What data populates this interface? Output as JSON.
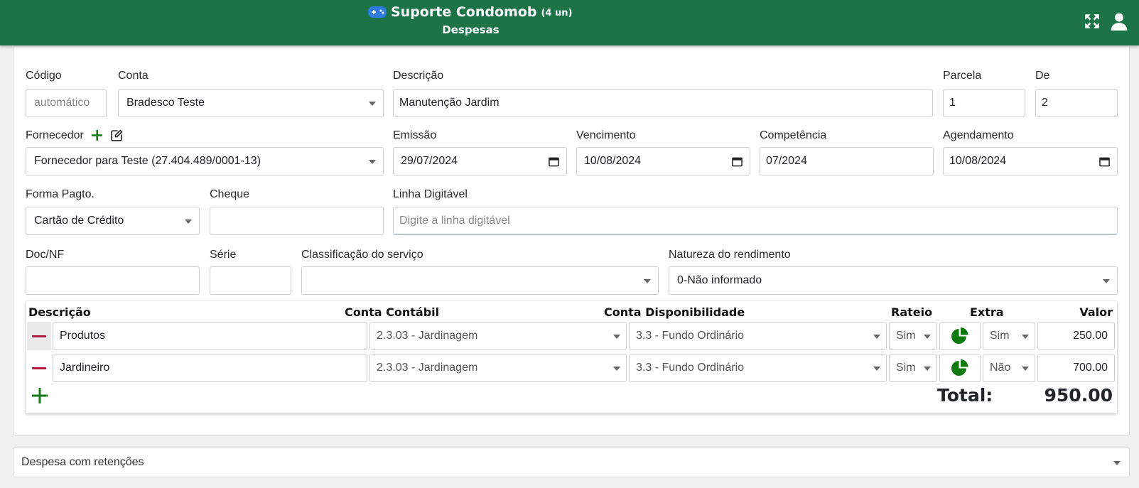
{
  "header": {
    "app_name": "Suporte Condomob",
    "units": "(4 un)",
    "page": "Despesas",
    "brand_color": "#1b7347",
    "icons": [
      "gamepad-icon",
      "fullscreen-icon",
      "user-icon"
    ]
  },
  "form": {
    "codigo": {
      "label": "Código",
      "placeholder": "automático"
    },
    "conta": {
      "label": "Conta",
      "value": "Bradesco Teste"
    },
    "descricao": {
      "label": "Descrição",
      "value": "Manutenção Jardim"
    },
    "parcela": {
      "label": "Parcela",
      "value": "1"
    },
    "de": {
      "label": "De",
      "value": "2"
    },
    "fornecedor": {
      "label": "Fornecedor",
      "value": "Fornecedor para Teste (27.404.489/0001-13)"
    },
    "emissao": {
      "label": "Emissão",
      "value": "29/07/2024"
    },
    "vencimento": {
      "label": "Vencimento",
      "value": "10/08/2024"
    },
    "competencia": {
      "label": "Competência",
      "value": "07/2024"
    },
    "agendamento": {
      "label": "Agendamento",
      "value": "10/08/2024"
    },
    "forma_pagto": {
      "label": "Forma Pagto.",
      "value": "Cartão de Crédito"
    },
    "cheque": {
      "label": "Cheque",
      "value": ""
    },
    "linha_digitavel": {
      "label": "Linha Digitável",
      "placeholder": "Digite a linha digitável"
    },
    "doc_nf": {
      "label": "Doc/NF",
      "value": ""
    },
    "serie": {
      "label": "Série",
      "value": ""
    },
    "classificacao": {
      "label": "Classificação do serviço",
      "value": ""
    },
    "natureza": {
      "label": "Natureza do rendimento",
      "value": "0-Não informado"
    }
  },
  "items": {
    "headers": {
      "descricao": "Descrição",
      "conta_contabil": "Conta Contábil",
      "conta_disponibilidade": "Conta Disponibilidade",
      "rateio": "Rateio",
      "extra": "Extra",
      "valor": "Valor"
    },
    "rows": [
      {
        "descricao": "Produtos",
        "conta_contabil": "2.3.03 - Jardinagem",
        "conta_disponibilidade": "3.3 - Fundo Ordinário",
        "rateio": "Sim",
        "extra": "Sim",
        "valor": "250.00"
      },
      {
        "descricao": "Jardineiro",
        "conta_contabil": "2.3.03 - Jardinagem",
        "conta_disponibilidade": "3.3 - Fundo Ordinário",
        "rateio": "Sim",
        "extra": "Não",
        "valor": "700.00"
      }
    ],
    "total_label": "Total:",
    "total_value": "950.00",
    "accent_minus": "#b2183b",
    "accent_plus": "#1b7a1b"
  },
  "retencoes": {
    "value": "Despesa com retenções"
  }
}
